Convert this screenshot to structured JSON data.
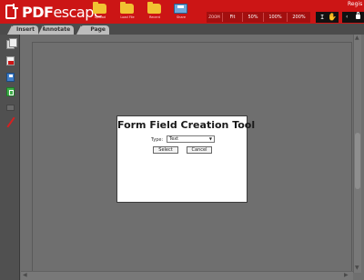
{
  "app": {
    "logo_prefix": "PDF",
    "logo_suffix": "escape",
    "top_right_text": "Regis"
  },
  "toolbar": {
    "tools": [
      {
        "label": "Upload",
        "icon": "folder-icon"
      },
      {
        "label": "Load File",
        "icon": "folder-icon"
      },
      {
        "label": "Recent",
        "icon": "folder-icon"
      },
      {
        "label": "Share",
        "icon": "share-icon"
      }
    ],
    "zoom_label": "ZOOM",
    "zoom_options": [
      "Fit",
      "50%",
      "100%",
      "200%"
    ]
  },
  "tabs": [
    "Insert",
    "Annotate",
    "Page"
  ],
  "sidebar": {
    "icons": [
      "pages-icon",
      "pdf-icon",
      "save-icon",
      "download-icon",
      "print-icon",
      "pen-icon"
    ]
  },
  "dialog": {
    "title": "Form Field Creation Tool",
    "type_label": "Type:",
    "type_value": "Text",
    "select_button": "Select",
    "cancel_button": "Cancel"
  },
  "colors": {
    "brand_red": "#cc1515",
    "workspace": "#6f6f6f"
  }
}
